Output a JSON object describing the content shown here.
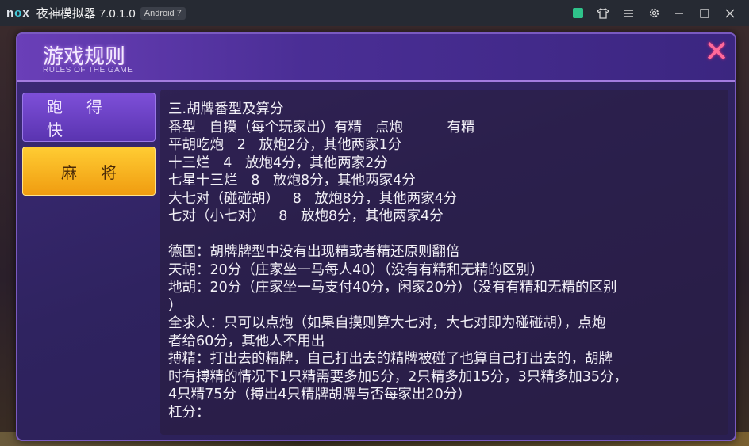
{
  "emulator": {
    "logo": "nox",
    "title": "夜神模拟器 7.0.1.0",
    "badge": "Android 7",
    "icons": [
      "app-store-icon",
      "shirt-icon",
      "menu-icon",
      "gear-icon",
      "minimize-icon",
      "maximize-icon",
      "close-icon"
    ]
  },
  "dialog": {
    "title": "游戏规则",
    "subtitle": "RULES OF THE GAME",
    "close_symbol": "✕"
  },
  "tabs": [
    {
      "label": "跑得快",
      "active": false
    },
    {
      "label": "麻将",
      "active": true
    }
  ],
  "rules_lines": [
    "三.胡牌番型及算分",
    "番型   自摸（每个玩家出）有精   点炮          有精",
    "平胡吃炮   2   放炮2分，其他两家1分",
    "十三烂   4   放炮4分，其他两家2分",
    "七星十三烂   8   放炮8分，其他两家4分",
    "大七对（碰碰胡）   8   放炮8分，其他两家4分",
    "七对（小七对）   8   放炮8分，其他两家4分",
    "",
    "德国：胡牌牌型中没有出现精或者精还原则翻倍",
    "天胡：20分（庄家坐一马每人40）（没有有精和无精的区别）",
    "地胡：20分（庄家坐一马支付40分，闲家20分）（没有有精和无精的区别",
    "）",
    "全求人：只可以点炮（如果自摸则算大七对，大七对即为碰碰胡），点炮",
    "者给60分，其他人不用出",
    "搏精：打出去的精牌，自己打出去的精牌被碰了也算自己打出去的，胡牌",
    "时有搏精的情况下1只精需要多加5分，2只精多加15分，3只精多加35分，",
    "4只精75分（搏出4只精牌胡牌与否每家出20分）",
    "杠分："
  ],
  "colors": {
    "dialog_bg": "#2f2360",
    "tab_active": "#f0a818",
    "tab_inactive": "#6a44c4",
    "close": "#ff6a9a",
    "text": "#f2f0f7"
  }
}
